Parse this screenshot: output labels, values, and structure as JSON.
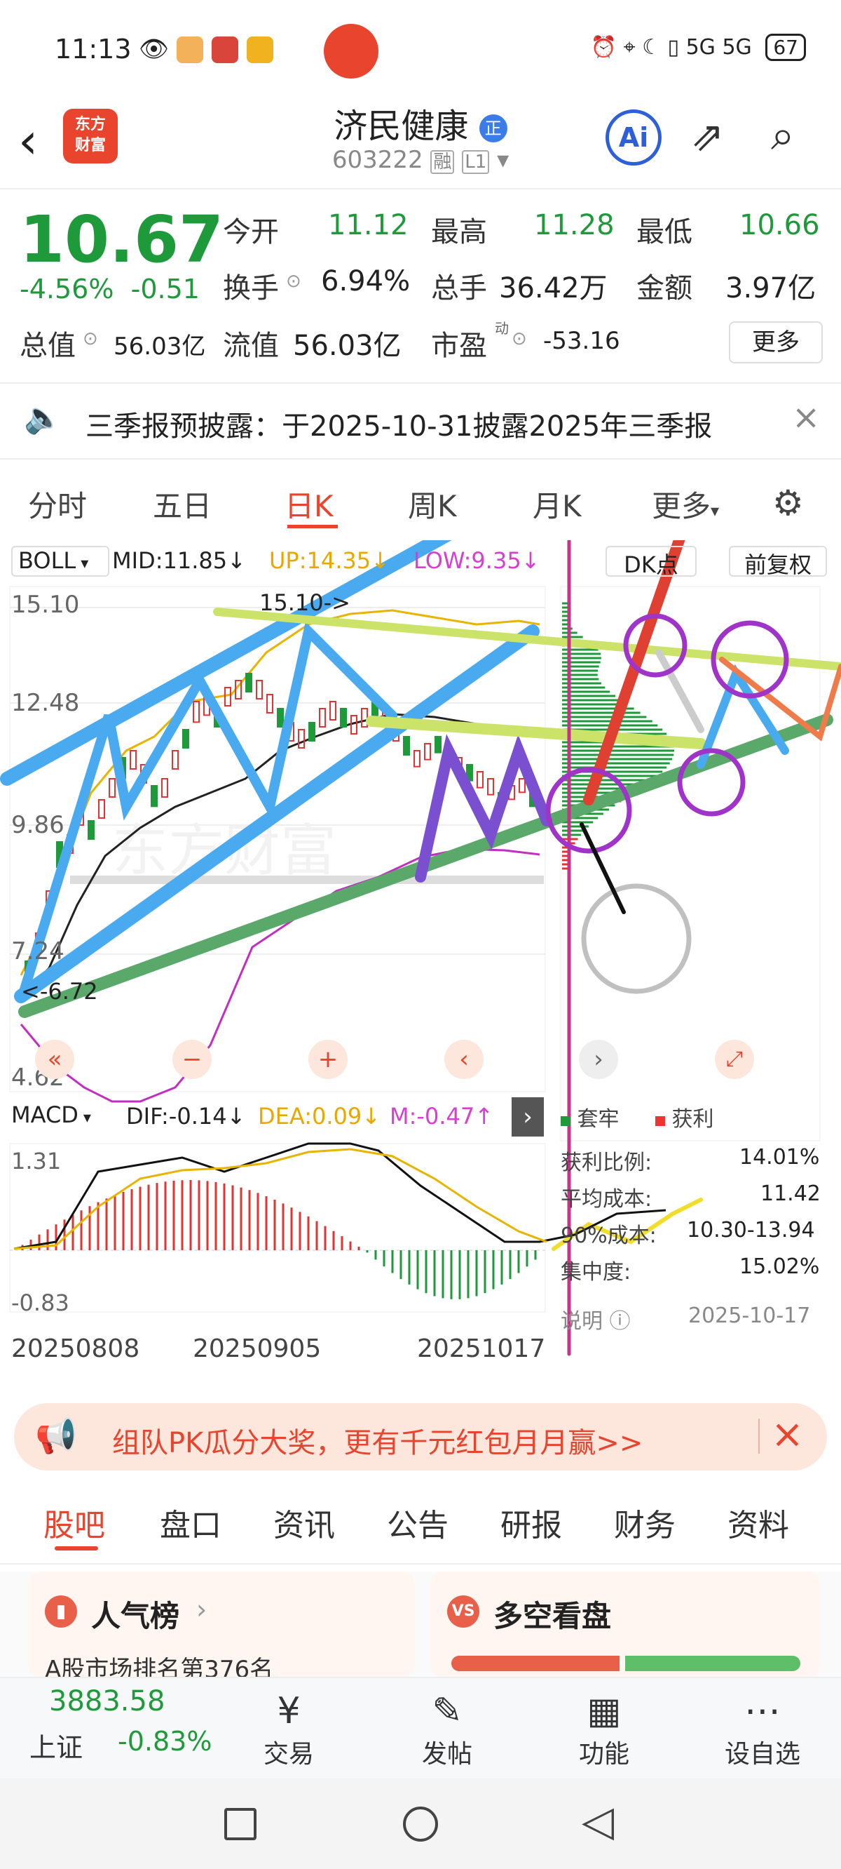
{
  "status": {
    "time": "11:13",
    "network": "5G 5G",
    "battery": "67"
  },
  "header": {
    "logo": "东方\n财富",
    "stock_name": "济民健康",
    "badge": "正",
    "stock_code": "603222",
    "rong": "融",
    "level": "L1",
    "ai": "Ai"
  },
  "quote": {
    "price": "10.67",
    "change_pct": "-4.56%",
    "change": "-0.51",
    "open_label": "今开",
    "open": "11.12",
    "high_label": "最高",
    "high": "11.28",
    "low_label": "最低",
    "low": "10.66",
    "turnover_label": "换手",
    "turnover": "6.94%",
    "volume_label": "总手",
    "volume": "36.42万",
    "amount_label": "金额",
    "amount": "3.97亿",
    "mcap_label": "总值",
    "mcap": "56.03亿",
    "float_label": "流值",
    "float": "56.03亿",
    "pe_label": "市盈",
    "pe_sup": "动",
    "pe": "-53.16",
    "more": "更多"
  },
  "notice": {
    "text": "三季报预披露：于2025-10-31披露2025年三季报"
  },
  "ktabs": [
    "分时",
    "五日",
    "日K",
    "周K",
    "月K",
    "更多"
  ],
  "ktab_active": 2,
  "indicators": {
    "boll": "BOLL",
    "mid": "MID:11.85↓",
    "up": "UP:14.35↓",
    "low": "LOW:9.35↓",
    "dk": "DK点",
    "fq": "前复权"
  },
  "yaxis": [
    "15.10",
    "12.48",
    "9.86",
    "7.24",
    "4.62"
  ],
  "annotations": {
    "high_tag": "15.10->",
    "low_tag": "<-6.72"
  },
  "macd": {
    "name": "MACD",
    "dif": "DIF:-0.14↓",
    "dea": "DEA:0.09↓",
    "m": "M:-0.47↑",
    "ymax": "1.31",
    "ymin": "-0.83"
  },
  "dates": [
    "20250808",
    "20250905",
    "20251017"
  ],
  "chip": {
    "legend_trap": "套牢",
    "legend_profit": "获利",
    "rows": [
      {
        "label": "获利比例:",
        "value": "14.01%"
      },
      {
        "label": "平均成本:",
        "value": "11.42"
      },
      {
        "label": "90%成本:",
        "value": "10.30-13.94"
      },
      {
        "label": "集中度:",
        "value": "15.02%"
      }
    ],
    "note": "说明",
    "date": "2025-10-17"
  },
  "watermark": "东方财富",
  "promo": {
    "text": "组队PK瓜分大奖，更有千元红包月月赢>>"
  },
  "subtabs": [
    "股吧",
    "盘口",
    "资讯",
    "公告",
    "研报",
    "财务",
    "资料"
  ],
  "cards": {
    "rank_title": "人气榜",
    "rank_text": "A股市场排名第376名",
    "bullbear_title": "多空看盘"
  },
  "bottom": {
    "index_value": "3883.58",
    "index_name": "上证",
    "index_change": "-0.83%",
    "items": [
      "交易",
      "发帖",
      "功能",
      "设自选"
    ]
  },
  "colors": {
    "up": "#e33333",
    "down": "#1f9a3b",
    "accent": "#e8442e",
    "drawing_blue": "#4aaaf0",
    "drawing_green": "#5aa86a",
    "drawing_purple": "#7a4fd0"
  },
  "chart_data": {
    "type": "candlestick",
    "title": "",
    "x": [
      "20250808",
      "20250905",
      "20251017"
    ],
    "ylim": [
      4.62,
      15.1
    ],
    "yticks": [
      15.1,
      12.48,
      9.86,
      7.24,
      4.62
    ],
    "labels": {
      "period_high": 15.1,
      "period_low": 6.72
    },
    "boll": {
      "mid": 11.85,
      "up": 14.35,
      "low": 9.35
    },
    "macd": {
      "dif": -0.14,
      "dea": 0.09,
      "m": -0.47,
      "ylim": [
        -0.83,
        1.31
      ]
    }
  }
}
